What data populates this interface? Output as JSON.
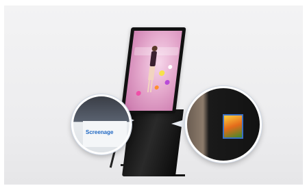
{
  "photo": {
    "subject": "kiosk-display-photo",
    "left_inset": {
      "label": "Screenage"
    }
  }
}
